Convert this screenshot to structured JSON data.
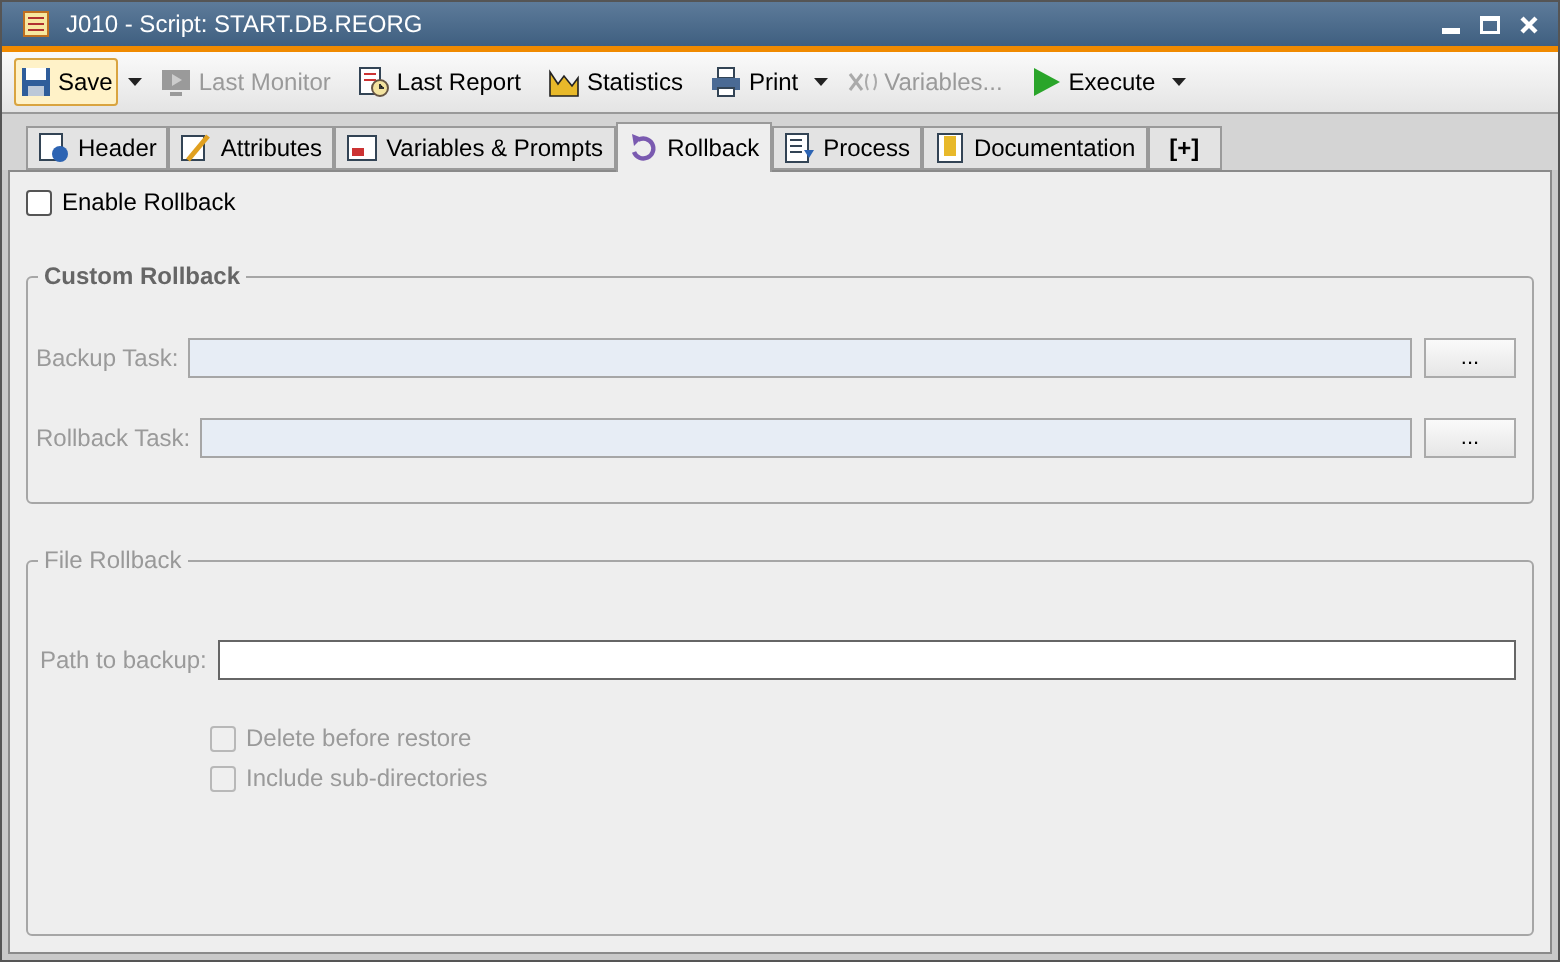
{
  "window": {
    "title": "J010 - Script: START.DB.REORG"
  },
  "toolbar": [
    {
      "label": "Save",
      "disabled": false,
      "focused": true,
      "dropdown": true
    },
    {
      "label": "Last Monitor",
      "disabled": true,
      "focused": false,
      "dropdown": false
    },
    {
      "label": "Last Report",
      "disabled": false,
      "focused": false,
      "dropdown": false
    },
    {
      "label": "Statistics",
      "disabled": false,
      "focused": false,
      "dropdown": false
    },
    {
      "label": "Print",
      "disabled": false,
      "focused": false,
      "dropdown": true
    },
    {
      "label": "Variables...",
      "disabled": true,
      "focused": false,
      "dropdown": false
    },
    {
      "label": "Execute",
      "disabled": false,
      "focused": false,
      "dropdown": true
    }
  ],
  "tabs": [
    {
      "label": "Header",
      "selected": false
    },
    {
      "label": "Attributes",
      "selected": false
    },
    {
      "label": "Variables & Prompts",
      "selected": false
    },
    {
      "label": "Rollback",
      "selected": true
    },
    {
      "label": "Process",
      "selected": false
    },
    {
      "label": "Documentation",
      "selected": false
    },
    {
      "label": "[+]",
      "selected": false
    }
  ],
  "enable_rollback": {
    "label": "Enable Rollback",
    "checked": false
  },
  "custom_rollback": {
    "title": "Custom Rollback",
    "disabled": true,
    "fields": [
      {
        "label": "Backup Task:",
        "browse": "..."
      },
      {
        "label": "Rollback Task:",
        "browse": "..."
      }
    ]
  },
  "file_rollback": {
    "title": "File Rollback",
    "disabled": true,
    "path": {
      "label": "Path to backup:"
    },
    "options": [
      {
        "label": "Delete before restore",
        "checked": false,
        "disabled": true
      },
      {
        "label": "Include sub-directories",
        "checked": false,
        "disabled": true
      }
    ]
  }
}
